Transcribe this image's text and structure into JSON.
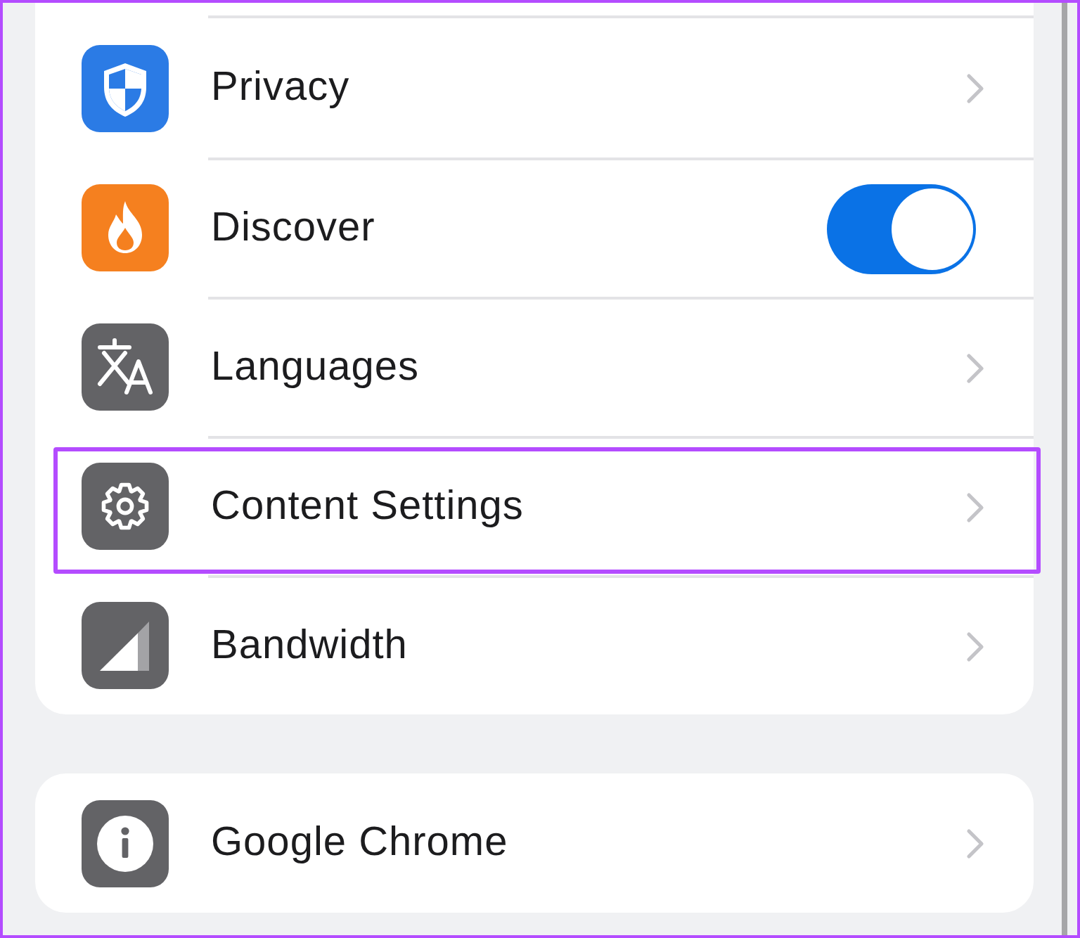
{
  "sections": [
    {
      "items": [
        {
          "kind": "link",
          "label": "Privacy",
          "highlighted": false
        },
        {
          "kind": "toggle",
          "label": "Discover",
          "on": true,
          "highlighted": false
        },
        {
          "kind": "link",
          "label": "Languages",
          "highlighted": false
        },
        {
          "kind": "link",
          "label": "Content Settings",
          "highlighted": true
        },
        {
          "kind": "link",
          "label": "Bandwidth",
          "highlighted": false
        }
      ]
    },
    {
      "items": [
        {
          "kind": "link",
          "label": "Google Chrome",
          "highlighted": false
        }
      ]
    }
  ]
}
